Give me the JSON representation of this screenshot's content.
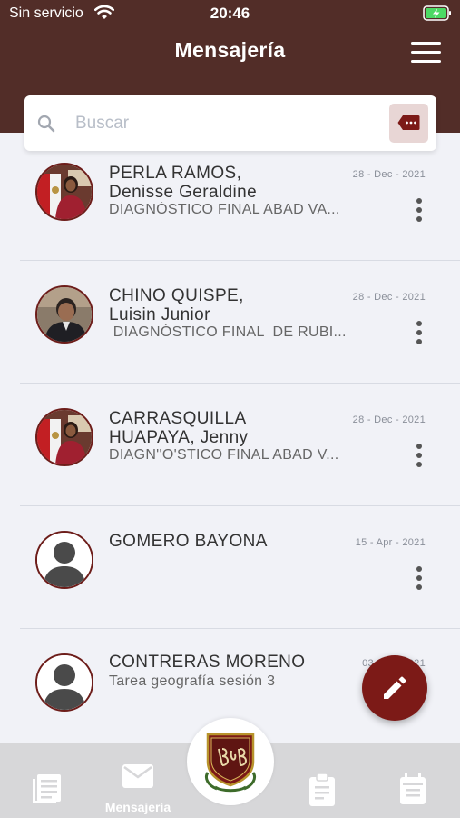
{
  "status_bar": {
    "carrier": "Sin servicio",
    "time": "20:46"
  },
  "header": {
    "title": "Mensajería"
  },
  "search": {
    "placeholder": "Buscar"
  },
  "messages": [
    {
      "name_line1": "PERLA RAMOS,",
      "name_line2": "Denisse Geraldine",
      "date": "28 - Dec - 2021",
      "subject": "DIAGNÓSTICO FINAL ABAD VA...",
      "avatar": "photo-woman"
    },
    {
      "name_line1": "CHINO QUISPE,",
      "name_line2": "Luisin Junior",
      "date": "28 - Dec - 2021",
      "subject": " DIAGNÓSTICO FINAL  DE RUBI...",
      "avatar": "photo-man"
    },
    {
      "name_line1": "CARRASQUILLA",
      "name_line2": "HUAPAYA, Jenny",
      "date": "28 - Dec - 2021",
      "subject": "DIAGN''O'STICO FINAL ABAD V...",
      "avatar": "photo-woman"
    },
    {
      "name_line1": "GOMERO BAYONA",
      "name_line2": "",
      "date": "15 - Apr - 2021",
      "subject": "",
      "avatar": "placeholder"
    },
    {
      "name_line1": "CONTRERAS MORENO",
      "name_line2": "",
      "date": "03 - ... - 2021",
      "subject": "Tarea geografía sesión 3",
      "avatar": "placeholder"
    }
  ],
  "bottom_nav": {
    "active_label": "Mensajería"
  },
  "colors": {
    "header": "#522d28",
    "accent": "#7c1a17",
    "filter_bg": "#e8d6d5"
  },
  "icons": [
    "wifi-icon",
    "battery-charging-icon",
    "menu-icon",
    "search-icon",
    "filter-tag-icon",
    "more-vertical-icon",
    "pencil-icon",
    "news-icon",
    "mail-icon",
    "school-logo",
    "clipboard-icon",
    "calendar-icon"
  ]
}
